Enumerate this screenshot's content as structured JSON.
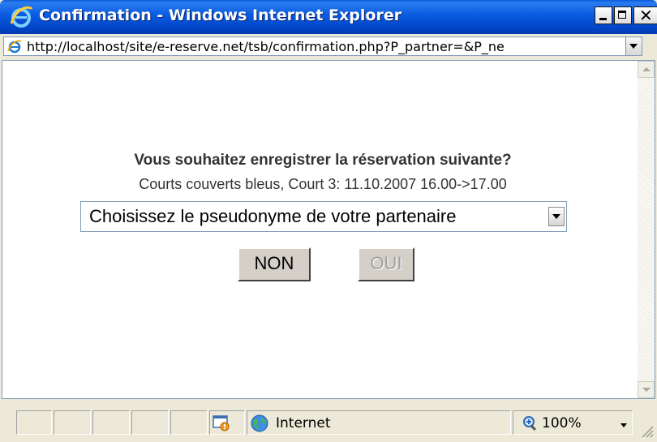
{
  "window": {
    "title": "Confirmation - Windows Internet Explorer",
    "close_glyph": "✕"
  },
  "address": {
    "url": "http://localhost/site/e-reserve.net/tsb/confirmation.php?P_partner=&P_ne"
  },
  "content": {
    "heading": "Vous souhaitez enregistrer la réservation suivante?",
    "details": "Courts couverts bleus, Court 3: 11.10.2007 16.00->17.00",
    "partner_select": {
      "value": "Choisissez le pseudonyme de votre partenaire"
    },
    "buttons": {
      "non": "NON",
      "oui": "OUI",
      "oui_enabled": false
    }
  },
  "status": {
    "zone": "Internet",
    "zoom": "100%"
  },
  "icons": {
    "title": "ie-logo-icon",
    "address": "ie-page-icon",
    "popup": "popup-blocked-icon",
    "zone": "internet-globe-icon",
    "zoom": "zoom-icon"
  }
}
